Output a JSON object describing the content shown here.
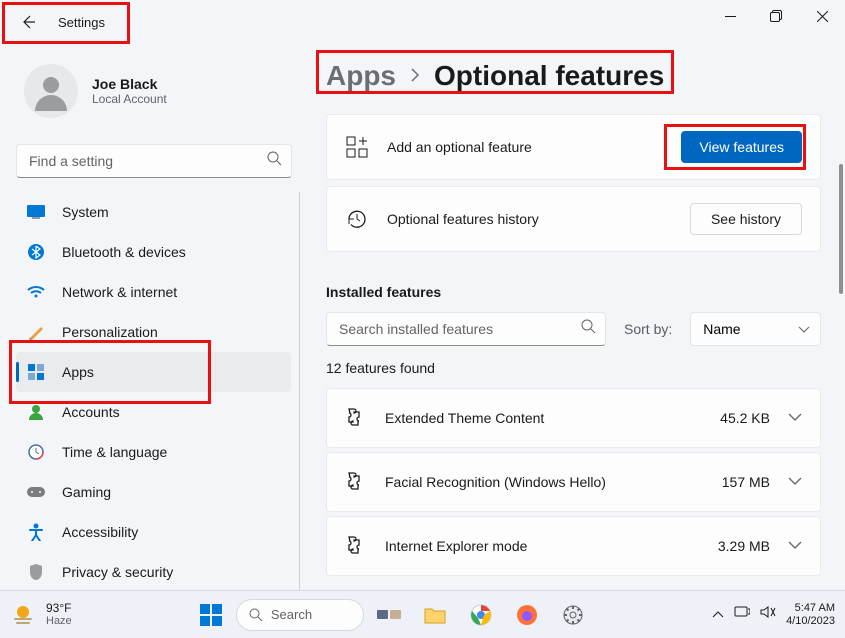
{
  "titlebar": {
    "title": "Settings"
  },
  "profile": {
    "name": "Joe Black",
    "subtitle": "Local Account"
  },
  "search": {
    "placeholder": "Find a setting"
  },
  "nav": [
    {
      "label": "System",
      "icon": "system"
    },
    {
      "label": "Bluetooth & devices",
      "icon": "bluetooth"
    },
    {
      "label": "Network & internet",
      "icon": "wifi"
    },
    {
      "label": "Personalization",
      "icon": "brush"
    },
    {
      "label": "Apps",
      "icon": "apps",
      "active": true
    },
    {
      "label": "Accounts",
      "icon": "person"
    },
    {
      "label": "Time & language",
      "icon": "clock"
    },
    {
      "label": "Gaming",
      "icon": "gamepad"
    },
    {
      "label": "Accessibility",
      "icon": "accessibility"
    },
    {
      "label": "Privacy & security",
      "icon": "shield"
    }
  ],
  "breadcrumb": {
    "parent": "Apps",
    "current": "Optional features"
  },
  "cards": {
    "add": {
      "label": "Add an optional feature",
      "button": "View features"
    },
    "history": {
      "label": "Optional features history",
      "button": "See history"
    }
  },
  "installed": {
    "header": "Installed features",
    "search_placeholder": "Search installed features",
    "sort_label": "Sort by:",
    "sort_value": "Name",
    "count": "12 features found",
    "items": [
      {
        "name": "Extended Theme Content",
        "size": "45.2 KB"
      },
      {
        "name": "Facial Recognition (Windows Hello)",
        "size": "157 MB"
      },
      {
        "name": "Internet Explorer mode",
        "size": "3.29 MB"
      }
    ]
  },
  "taskbar": {
    "weather": {
      "temp": "93°F",
      "cond": "Haze"
    },
    "search": "Search",
    "time": "5:47 AM",
    "date": "4/10/2023"
  }
}
